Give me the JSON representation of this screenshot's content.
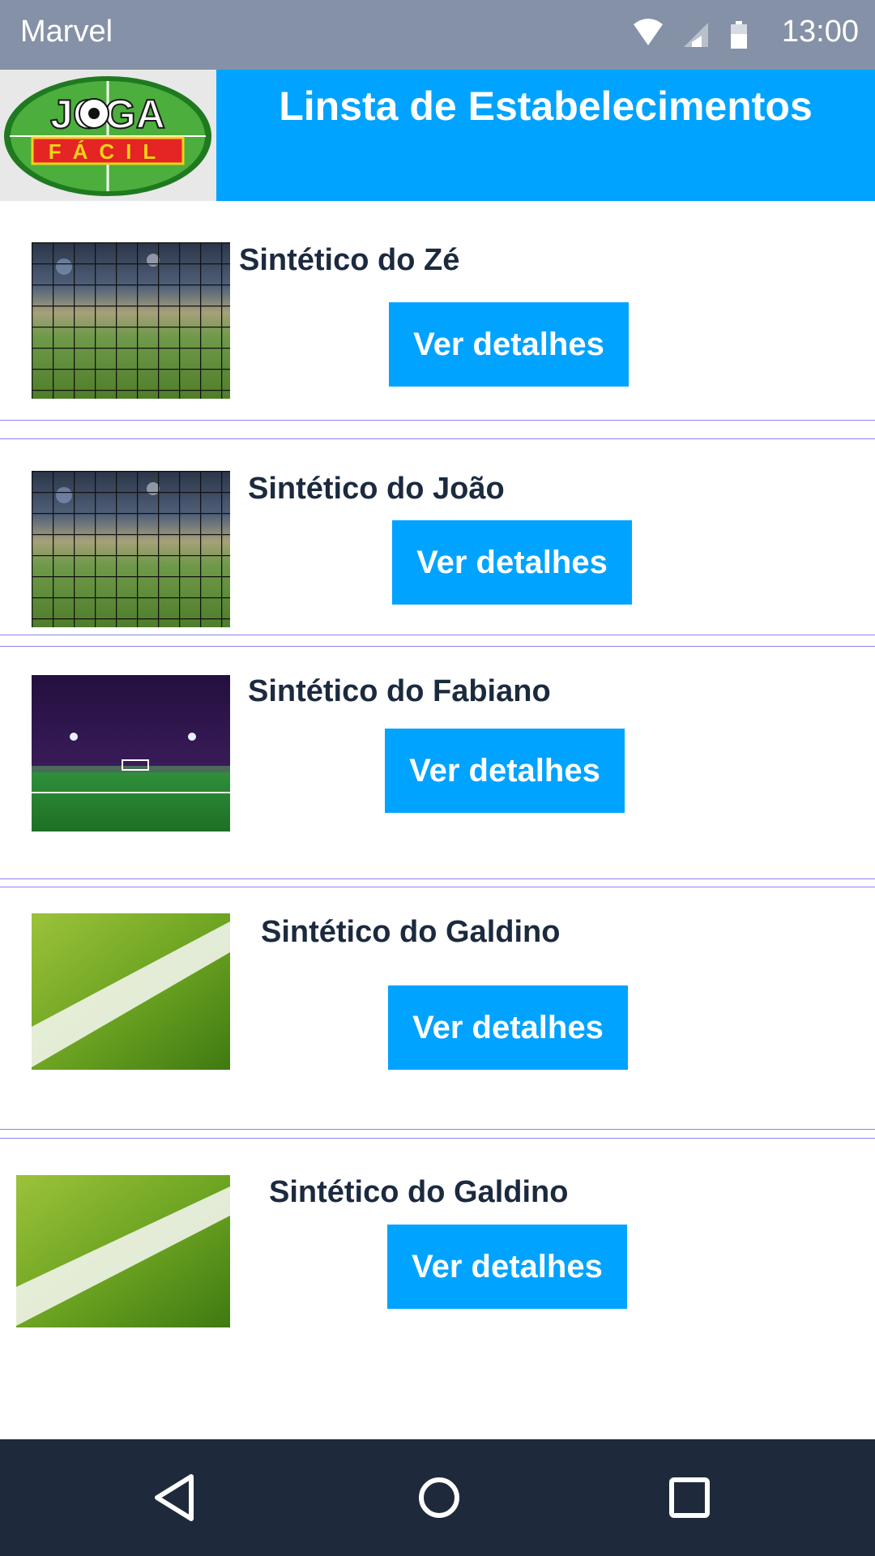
{
  "status_bar": {
    "app_name": "Marvel",
    "time": "13:00",
    "icons": [
      "wifi-icon",
      "signal-icon",
      "battery-icon"
    ]
  },
  "header": {
    "logo_text_top": "JOGA",
    "logo_text_bottom": "FÁCIL",
    "title": "Linsta de Estabelecimentos"
  },
  "colors": {
    "accent": "#00a3ff",
    "status_bar": "#8591a6",
    "nav_bar": "#1e2a3c",
    "text_dark": "#1c2a3f",
    "separator": "#8a84f0"
  },
  "items": [
    {
      "name": "Sintético do Zé",
      "button_label": "Ver detalhes",
      "image": "soccer-net-photo"
    },
    {
      "name": "Sintético do João",
      "button_label": "Ver detalhes",
      "image": "soccer-net-photo"
    },
    {
      "name": "Sintético do Fabiano",
      "button_label": "Ver detalhes",
      "image": "night-field-photo"
    },
    {
      "name": "Sintético do Galdino",
      "button_label": "Ver detalhes",
      "image": "grass-line-photo"
    },
    {
      "name": "Sintético do Galdino",
      "button_label": "Ver detalhes",
      "image": "grass-line-photo"
    }
  ],
  "nav_bar": {
    "buttons": [
      "back-icon",
      "home-icon",
      "recents-icon"
    ]
  }
}
